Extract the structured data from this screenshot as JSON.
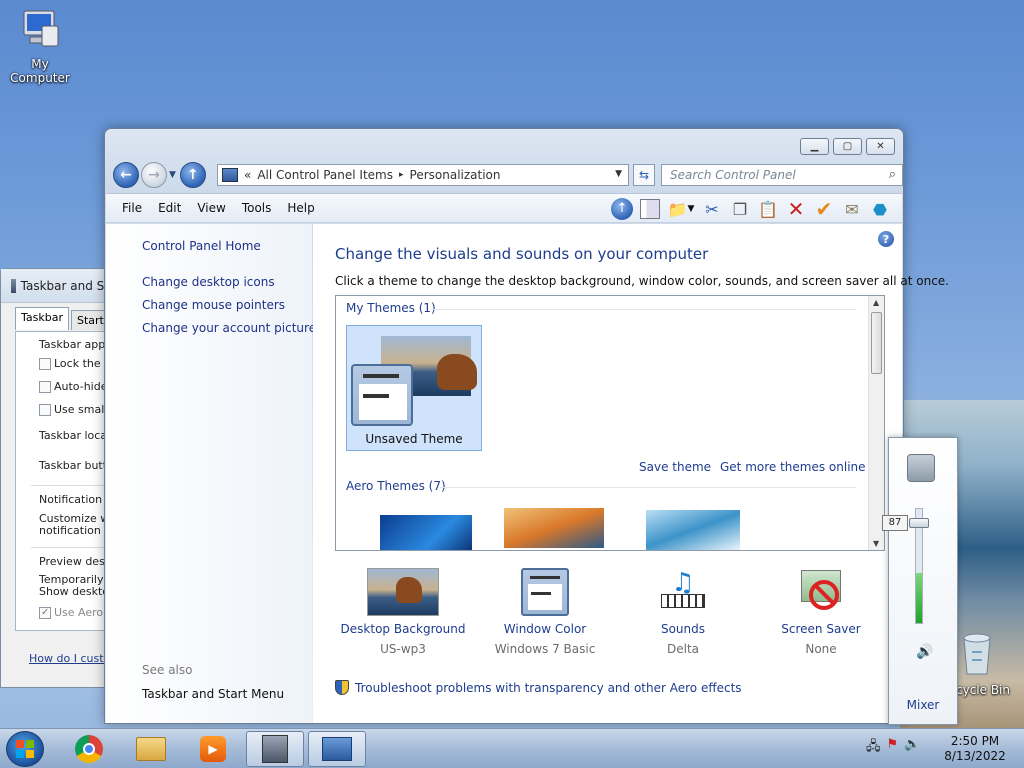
{
  "desktop": {
    "icons": [
      {
        "label": "My Computer"
      },
      {
        "label": "cycle Bin"
      }
    ]
  },
  "bg_window": {
    "title": "Taskbar and St",
    "tabs": [
      "Taskbar",
      "Start M"
    ],
    "rows": {
      "taskbar_appearance": "Taskbar appe",
      "lock": "Lock the ta",
      "autohide": "Auto-hide",
      "small_icons": "Use small i",
      "location": "Taskbar locati",
      "buttons": "Taskbar butto",
      "notification": "Notification ar",
      "customize1": "Customize wh",
      "customize2": "notification ar",
      "preview": "Preview deskt",
      "temp1": "Temporarily vi",
      "temp2": "Show desktop",
      "aero": "Use Aero P",
      "howto": "How do I custo"
    }
  },
  "window": {
    "breadcrumb": {
      "chevrons": "«",
      "items": [
        "All Control Panel Items",
        "Personalization"
      ],
      "separator": "▸"
    },
    "search_placeholder": "Search Control Panel",
    "menu": [
      "File",
      "Edit",
      "View",
      "Tools",
      "Help"
    ],
    "left_links": [
      "Control Panel Home",
      "Change desktop icons",
      "Change mouse pointers",
      "Change your account picture"
    ],
    "see_also": "See also",
    "see_also_link": "Taskbar and Start Menu",
    "heading": "Change the visuals and sounds on your computer",
    "subtext": "Click a theme to change the desktop background, window color, sounds, and screen saver all at once.",
    "my_themes": "My Themes (1)",
    "selected_theme": "Unsaved Theme",
    "save_theme": "Save theme",
    "get_more": "Get more themes online",
    "aero_themes": "Aero Themes (7)",
    "bottom": [
      {
        "label": "Desktop Background",
        "value": "US-wp3"
      },
      {
        "label": "Window Color",
        "value": "Windows 7 Basic"
      },
      {
        "label": "Sounds",
        "value": "Delta"
      },
      {
        "label": "Screen Saver",
        "value": "None"
      }
    ],
    "troubleshoot": "Troubleshoot problems with transparency and other Aero effects"
  },
  "volume": {
    "level": "87",
    "level_fraction": 0.87,
    "mixer": "Mixer"
  },
  "taskbar": {
    "time": "2:50 PM",
    "date": "8/13/2022"
  }
}
